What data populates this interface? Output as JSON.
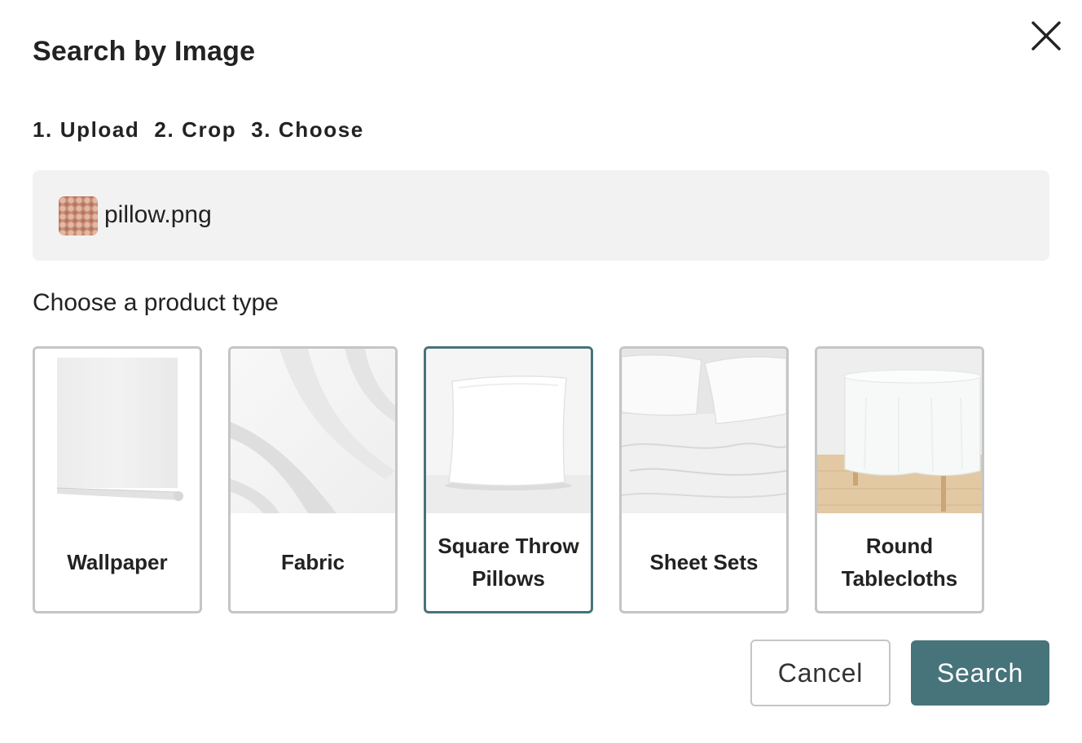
{
  "dialog": {
    "title": "Search by Image",
    "close_icon": "close-icon"
  },
  "steps": [
    {
      "label": "1. Upload"
    },
    {
      "label": "2. Crop"
    },
    {
      "label": "3. Choose"
    }
  ],
  "upload": {
    "filename": "pillow.png",
    "thumbnail_icon": "pillow-thumbnail"
  },
  "product_type": {
    "heading": "Choose a product type",
    "selected_index": 2,
    "options": [
      {
        "label": "Wallpaper",
        "image": "wallpaper-roll"
      },
      {
        "label": "Fabric",
        "image": "fabric-drape"
      },
      {
        "label": "Square Throw Pillows",
        "image": "square-pillow"
      },
      {
        "label": "Sheet Sets",
        "image": "bed-sheets"
      },
      {
        "label": "Round Tablecloths",
        "image": "round-table"
      }
    ]
  },
  "actions": {
    "cancel_label": "Cancel",
    "search_label": "Search"
  },
  "colors": {
    "accent": "#47737b",
    "upload_bg": "#f1f2f1",
    "card_border": "#c4c6c6"
  }
}
